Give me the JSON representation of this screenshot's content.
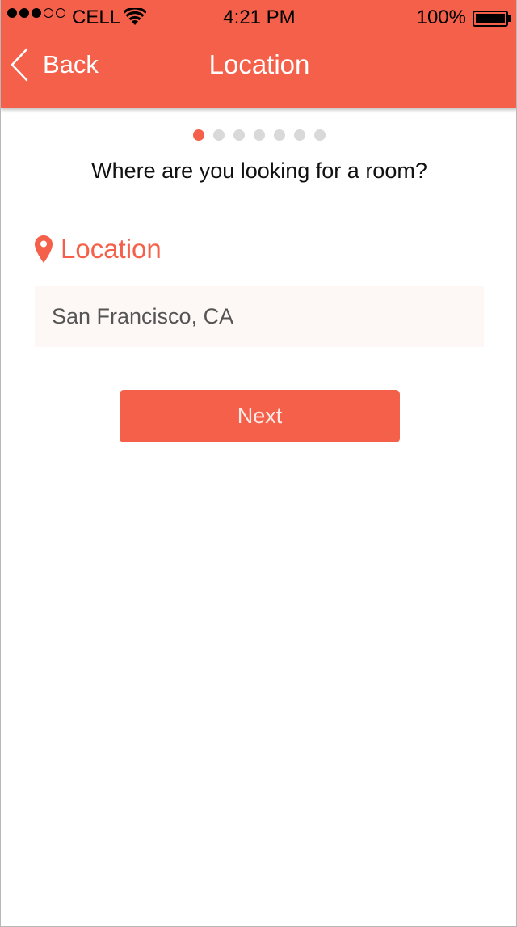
{
  "status_bar": {
    "carrier": "CELL",
    "time": "4:21 PM",
    "battery_percent": "100%",
    "signal_strength": {
      "filled": 3,
      "total": 5
    },
    "battery_level": 1.0
  },
  "nav": {
    "back_label": "Back",
    "title": "Location",
    "icons": {
      "back": "chevron-left-icon"
    }
  },
  "pager": {
    "total": 7,
    "current": 1
  },
  "question": "Where are you looking for a room?",
  "location_field": {
    "label": "Location",
    "icon": "map-pin-icon",
    "value": "San Francisco, CA",
    "placeholder": ""
  },
  "next_button": {
    "label": "Next"
  },
  "colors": {
    "accent": "#f5604a",
    "inactive_dot": "#d9d9d9",
    "input_background": "#fdf8f5"
  }
}
